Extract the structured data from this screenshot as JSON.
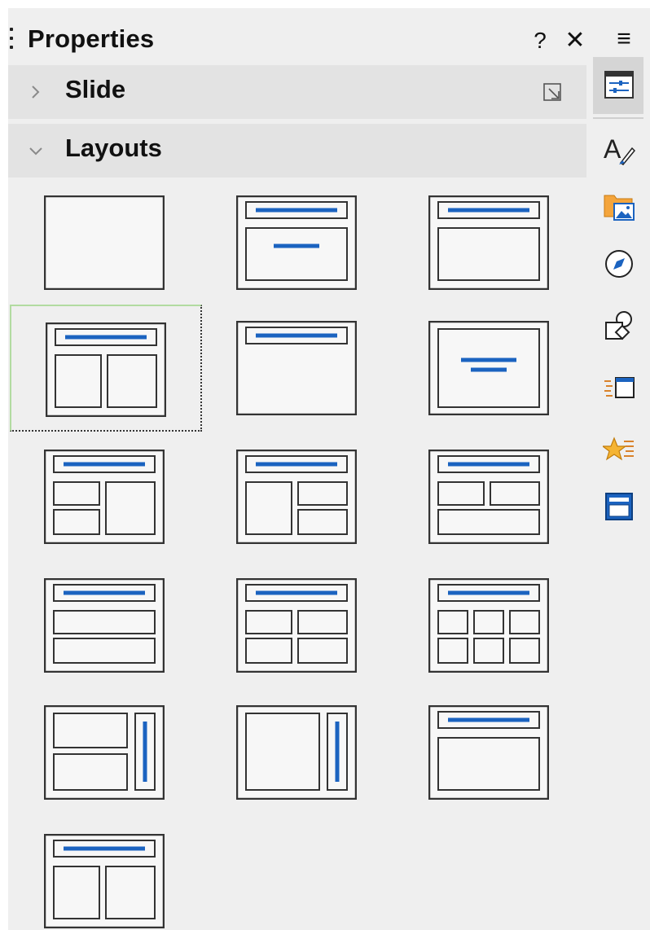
{
  "window": {
    "title": "Properties",
    "help_label": "?",
    "close_label": "✕",
    "menu_label": "≡"
  },
  "sections": {
    "slide": {
      "label": "Slide",
      "expanded": false
    },
    "layouts": {
      "label": "Layouts",
      "expanded": true
    }
  },
  "layouts": {
    "selected": "title-2-content",
    "items": [
      "blank",
      "title-subtitle",
      "title-content",
      "title-2-content",
      "title-only",
      "centered-text",
      "title-2-content-and-content",
      "title-content-and-2-content",
      "title-2-content-over-content",
      "title-content-over-content",
      "title-4-content",
      "title-6-content",
      "title-vertical-2-content",
      "title-vertical-content",
      "title-vertical-content-2",
      "title-2-content-alt"
    ]
  },
  "deck": {
    "active": "properties",
    "items": [
      "properties",
      "styles",
      "gallery",
      "navigator",
      "shapes",
      "slide-transition",
      "animation",
      "master-slides"
    ]
  },
  "colors": {
    "accent": "#1b63c0",
    "panel_bg": "#efefef",
    "section_bg": "#e3e3e3",
    "selection_border": "#b2dba1"
  }
}
